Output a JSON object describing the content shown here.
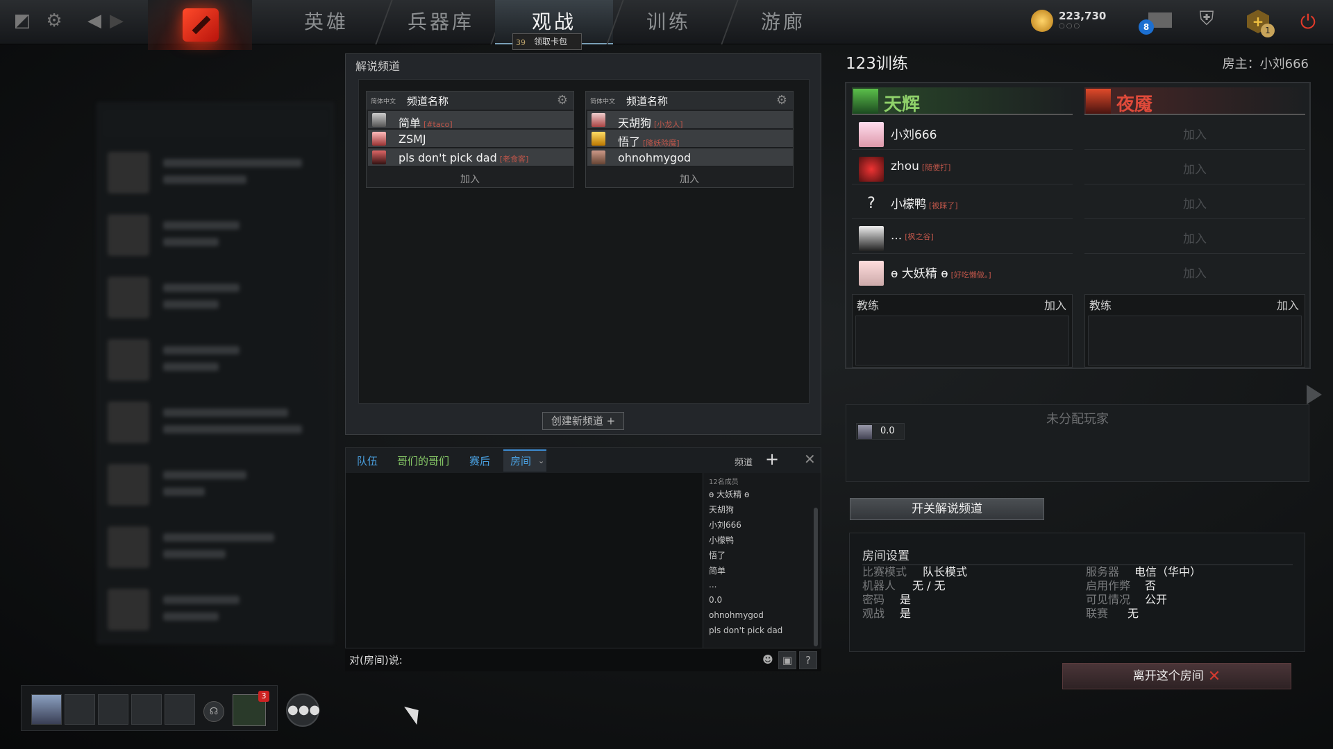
{
  "topbar": {
    "nav": [
      "英雄",
      "兵器库",
      "观战",
      "训练",
      "游廊"
    ],
    "active": "观战",
    "battlepass_level": "39",
    "tooltip": "领取卡包",
    "gold": "223,730",
    "gold_sub": "○○○",
    "mail_count": "8",
    "plus_count": "1"
  },
  "broadcast": {
    "title": "解说频道",
    "channels": [
      {
        "lang": "简体中文",
        "name": "频道名称",
        "members": [
          {
            "name": "简单",
            "tag": "[#taco]"
          },
          {
            "name": "ZSMJ",
            "tag": ""
          },
          {
            "name": "pls don't pick dad",
            "tag": "[老食客]"
          }
        ],
        "join": "加入"
      },
      {
        "lang": "简体中文",
        "name": "频道名称",
        "members": [
          {
            "name": "天胡狗",
            "tag": "[小龙人]"
          },
          {
            "name": "悟了",
            "tag": "[降妖除魔]"
          },
          {
            "name": "ohnohmygod",
            "tag": ""
          }
        ],
        "join": "加入"
      }
    ],
    "create": "创建新频道 +"
  },
  "chat": {
    "tabs": [
      "队伍",
      "哥们的哥们",
      "赛后",
      "房间"
    ],
    "channel_label": "频道",
    "members_header": "12名成员",
    "members": [
      "ɵ 大妖精 ɵ",
      "天胡狗",
      "小刘666",
      "小檬鸭",
      "悟了",
      "简单",
      "...",
      "0.0",
      "ohnohmygod",
      "pls don't pick dad"
    ],
    "input_label": "对(房间)说:"
  },
  "lobby": {
    "title": "123训练",
    "host": "房主：小刘666",
    "radiant": {
      "name": "天辉",
      "slots": [
        {
          "name": "小刘666",
          "tag": ""
        },
        {
          "name": "zhou",
          "tag": "[随便打]"
        },
        {
          "name": "小檬鸭",
          "tag": "[被踩了]"
        },
        {
          "name": "...",
          "tag": "[枫之谷]"
        },
        {
          "name": "ɵ 大妖精 ɵ",
          "tag": "[好吃懒做。]"
        }
      ]
    },
    "dire": {
      "name": "夜魇",
      "slots": [
        "加入",
        "加入",
        "加入",
        "加入",
        "加入"
      ]
    },
    "coach_label": "教练",
    "join_label": "加入",
    "unassigned_title": "未分配玩家",
    "unassigned_player": "0.0",
    "toggle_broadcast": "开关解说频道",
    "settings": {
      "title": "房间设置",
      "left": [
        [
          "比赛模式",
          "队长模式"
        ],
        [
          "机器人",
          "无 / 无"
        ],
        [
          "密码",
          "是"
        ],
        [
          "观战",
          "是"
        ]
      ],
      "right": [
        [
          "服务器",
          "电信（华中）"
        ],
        [
          "启用作弊",
          "否"
        ],
        [
          "可见情况",
          "公开"
        ],
        [
          "联赛",
          "无"
        ]
      ]
    },
    "leave": "离开这个房间"
  },
  "party": {
    "card_count": "3"
  },
  "colors": {
    "radiant": "#8fd16a",
    "dire": "#e04a3a",
    "accent": "#3d8bd0"
  }
}
